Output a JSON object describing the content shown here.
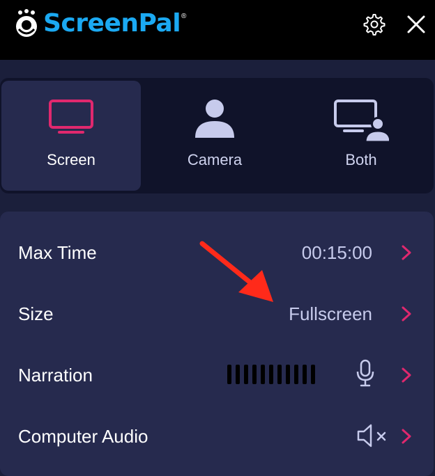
{
  "header": {
    "brand": "ScreenPal",
    "brand_mark": "®",
    "icons": [
      "screenpal-logo-icon",
      "gear-icon",
      "close-icon"
    ]
  },
  "modes": [
    {
      "label": "Screen",
      "icon": "monitor-icon",
      "active": true
    },
    {
      "label": "Camera",
      "icon": "person-icon",
      "active": false
    },
    {
      "label": "Both",
      "icon": "monitor-person-icon",
      "active": false
    }
  ],
  "settings": {
    "max_time": {
      "label": "Max Time",
      "value": "00:15:00"
    },
    "size": {
      "label": "Size",
      "value": "Fullscreen"
    },
    "narration": {
      "label": "Narration",
      "meter_bars": 11
    },
    "computer_audio": {
      "label": "Computer Audio",
      "muted": true
    }
  },
  "colors": {
    "brand": "#1ba9f2",
    "accent": "#e0286e",
    "panel": "#262a4e",
    "background": "#1b1f3b",
    "annotation_arrow": "#ff2a1a"
  }
}
